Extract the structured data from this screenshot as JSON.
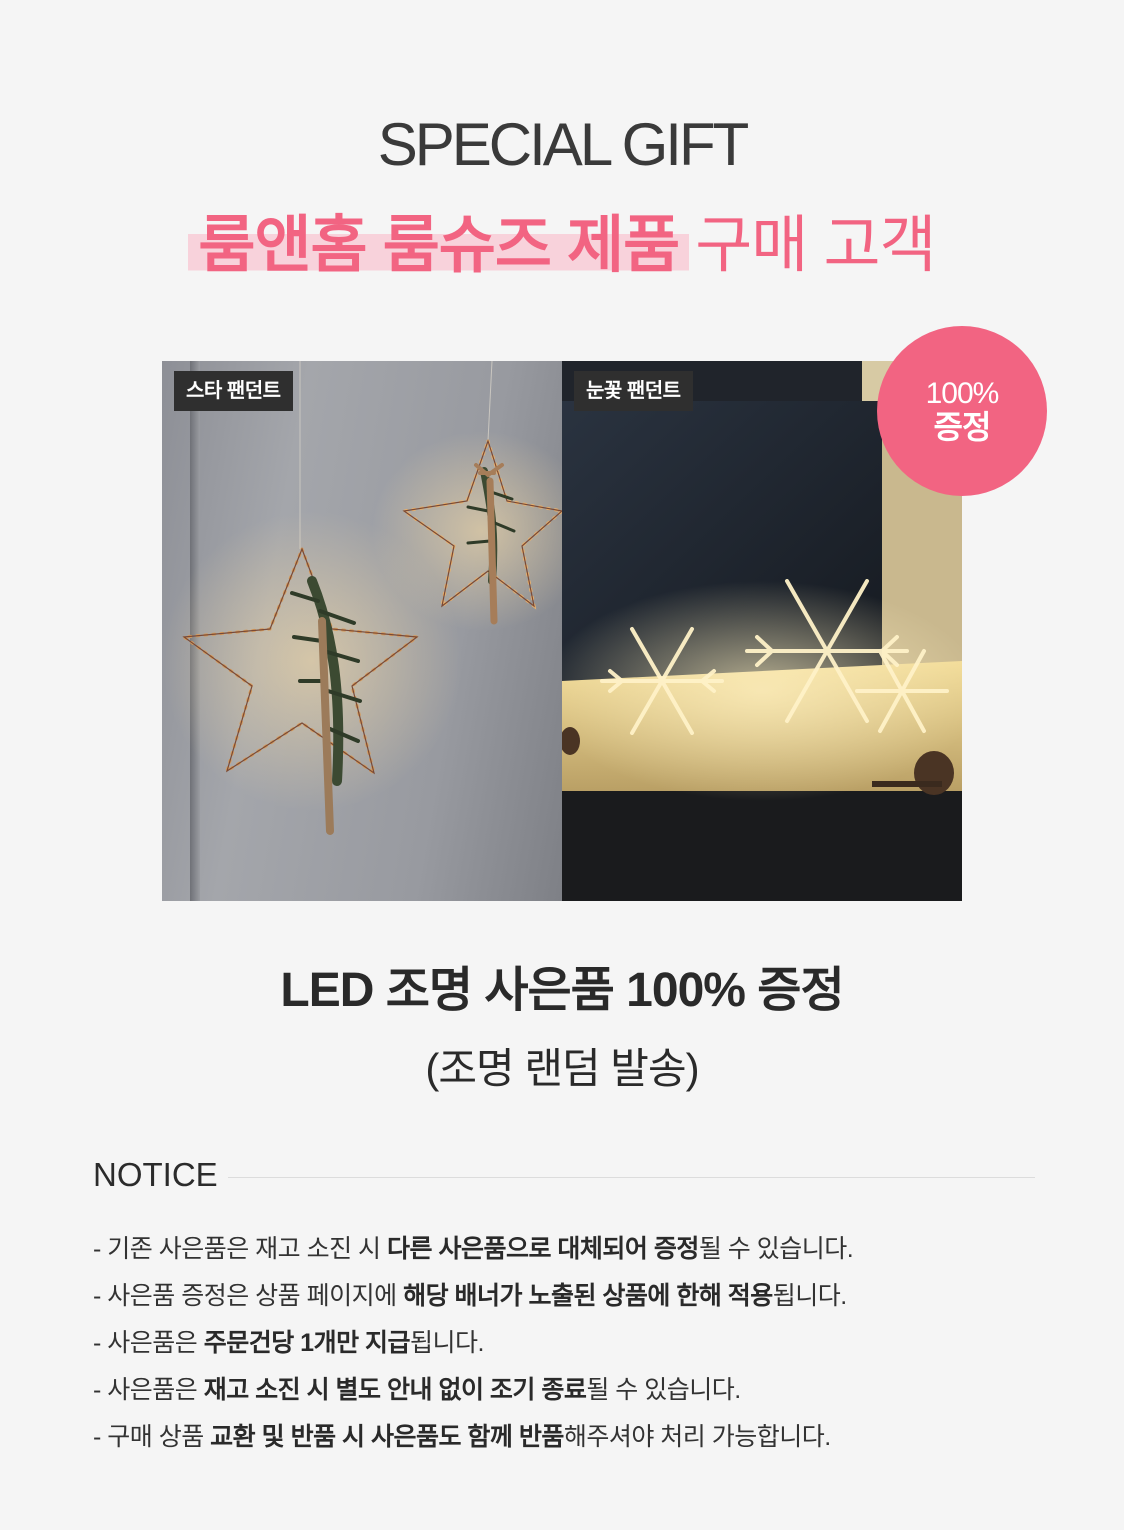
{
  "header": {
    "eyebrow": "SPECIAL GIFT",
    "headline_highlight": "룸앤홈 룸슈즈 제품",
    "headline_rest": "구매 고객",
    "accent_color": "#f26482"
  },
  "photos": {
    "left_tag": "스타 팬던트",
    "right_tag": "눈꽃 팬던트"
  },
  "badge": {
    "line1": "100%",
    "line2": "증정",
    "color": "#f26482"
  },
  "gift": {
    "title": "LED 조명 사은품 100% 증정",
    "subtitle": "(조명 랜덤 발송)"
  },
  "notice": {
    "title": "NOTICE",
    "items": [
      {
        "pre": "-  기존 사은품은 재고 소진 시 ",
        "bold": "다른 사은품으로 대체되어 증정",
        "post": "될 수 있습니다."
      },
      {
        "pre": "-  사은품 증정은 상품 페이지에 ",
        "bold": "해당 배너가 노출된 상품에 한해 적용",
        "post": "됩니다."
      },
      {
        "pre": "- 사은품은 ",
        "bold": "주문건당 1개만 지급",
        "post": "됩니다."
      },
      {
        "pre": "- 사은품은 ",
        "bold": "재고 소진 시 별도 안내 없이 조기 종료",
        "post": "될 수 있습니다."
      },
      {
        "pre": "- 구매 상품 ",
        "bold": "교환 및 반품 시 사은품도 함께 반품",
        "post": "해주셔야 처리 가능합니다."
      }
    ]
  }
}
